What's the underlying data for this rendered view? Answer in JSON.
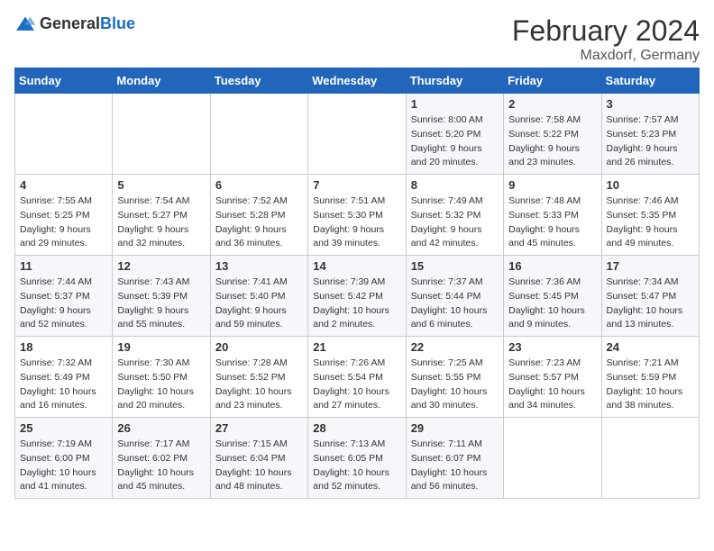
{
  "logo": {
    "text_general": "General",
    "text_blue": "Blue"
  },
  "header": {
    "title": "February 2024",
    "subtitle": "Maxdorf, Germany"
  },
  "days_of_week": [
    "Sunday",
    "Monday",
    "Tuesday",
    "Wednesday",
    "Thursday",
    "Friday",
    "Saturday"
  ],
  "weeks": [
    [
      {
        "day": "",
        "info": ""
      },
      {
        "day": "",
        "info": ""
      },
      {
        "day": "",
        "info": ""
      },
      {
        "day": "",
        "info": ""
      },
      {
        "day": "1",
        "info": "Sunrise: 8:00 AM\nSunset: 5:20 PM\nDaylight: 9 hours\nand 20 minutes."
      },
      {
        "day": "2",
        "info": "Sunrise: 7:58 AM\nSunset: 5:22 PM\nDaylight: 9 hours\nand 23 minutes."
      },
      {
        "day": "3",
        "info": "Sunrise: 7:57 AM\nSunset: 5:23 PM\nDaylight: 9 hours\nand 26 minutes."
      }
    ],
    [
      {
        "day": "4",
        "info": "Sunrise: 7:55 AM\nSunset: 5:25 PM\nDaylight: 9 hours\nand 29 minutes."
      },
      {
        "day": "5",
        "info": "Sunrise: 7:54 AM\nSunset: 5:27 PM\nDaylight: 9 hours\nand 32 minutes."
      },
      {
        "day": "6",
        "info": "Sunrise: 7:52 AM\nSunset: 5:28 PM\nDaylight: 9 hours\nand 36 minutes."
      },
      {
        "day": "7",
        "info": "Sunrise: 7:51 AM\nSunset: 5:30 PM\nDaylight: 9 hours\nand 39 minutes."
      },
      {
        "day": "8",
        "info": "Sunrise: 7:49 AM\nSunset: 5:32 PM\nDaylight: 9 hours\nand 42 minutes."
      },
      {
        "day": "9",
        "info": "Sunrise: 7:48 AM\nSunset: 5:33 PM\nDaylight: 9 hours\nand 45 minutes."
      },
      {
        "day": "10",
        "info": "Sunrise: 7:46 AM\nSunset: 5:35 PM\nDaylight: 9 hours\nand 49 minutes."
      }
    ],
    [
      {
        "day": "11",
        "info": "Sunrise: 7:44 AM\nSunset: 5:37 PM\nDaylight: 9 hours\nand 52 minutes."
      },
      {
        "day": "12",
        "info": "Sunrise: 7:43 AM\nSunset: 5:39 PM\nDaylight: 9 hours\nand 55 minutes."
      },
      {
        "day": "13",
        "info": "Sunrise: 7:41 AM\nSunset: 5:40 PM\nDaylight: 9 hours\nand 59 minutes."
      },
      {
        "day": "14",
        "info": "Sunrise: 7:39 AM\nSunset: 5:42 PM\nDaylight: 10 hours\nand 2 minutes."
      },
      {
        "day": "15",
        "info": "Sunrise: 7:37 AM\nSunset: 5:44 PM\nDaylight: 10 hours\nand 6 minutes."
      },
      {
        "day": "16",
        "info": "Sunrise: 7:36 AM\nSunset: 5:45 PM\nDaylight: 10 hours\nand 9 minutes."
      },
      {
        "day": "17",
        "info": "Sunrise: 7:34 AM\nSunset: 5:47 PM\nDaylight: 10 hours\nand 13 minutes."
      }
    ],
    [
      {
        "day": "18",
        "info": "Sunrise: 7:32 AM\nSunset: 5:49 PM\nDaylight: 10 hours\nand 16 minutes."
      },
      {
        "day": "19",
        "info": "Sunrise: 7:30 AM\nSunset: 5:50 PM\nDaylight: 10 hours\nand 20 minutes."
      },
      {
        "day": "20",
        "info": "Sunrise: 7:28 AM\nSunset: 5:52 PM\nDaylight: 10 hours\nand 23 minutes."
      },
      {
        "day": "21",
        "info": "Sunrise: 7:26 AM\nSunset: 5:54 PM\nDaylight: 10 hours\nand 27 minutes."
      },
      {
        "day": "22",
        "info": "Sunrise: 7:25 AM\nSunset: 5:55 PM\nDaylight: 10 hours\nand 30 minutes."
      },
      {
        "day": "23",
        "info": "Sunrise: 7:23 AM\nSunset: 5:57 PM\nDaylight: 10 hours\nand 34 minutes."
      },
      {
        "day": "24",
        "info": "Sunrise: 7:21 AM\nSunset: 5:59 PM\nDaylight: 10 hours\nand 38 minutes."
      }
    ],
    [
      {
        "day": "25",
        "info": "Sunrise: 7:19 AM\nSunset: 6:00 PM\nDaylight: 10 hours\nand 41 minutes."
      },
      {
        "day": "26",
        "info": "Sunrise: 7:17 AM\nSunset: 6:02 PM\nDaylight: 10 hours\nand 45 minutes."
      },
      {
        "day": "27",
        "info": "Sunrise: 7:15 AM\nSunset: 6:04 PM\nDaylight: 10 hours\nand 48 minutes."
      },
      {
        "day": "28",
        "info": "Sunrise: 7:13 AM\nSunset: 6:05 PM\nDaylight: 10 hours\nand 52 minutes."
      },
      {
        "day": "29",
        "info": "Sunrise: 7:11 AM\nSunset: 6:07 PM\nDaylight: 10 hours\nand 56 minutes."
      },
      {
        "day": "",
        "info": ""
      },
      {
        "day": "",
        "info": ""
      }
    ]
  ]
}
